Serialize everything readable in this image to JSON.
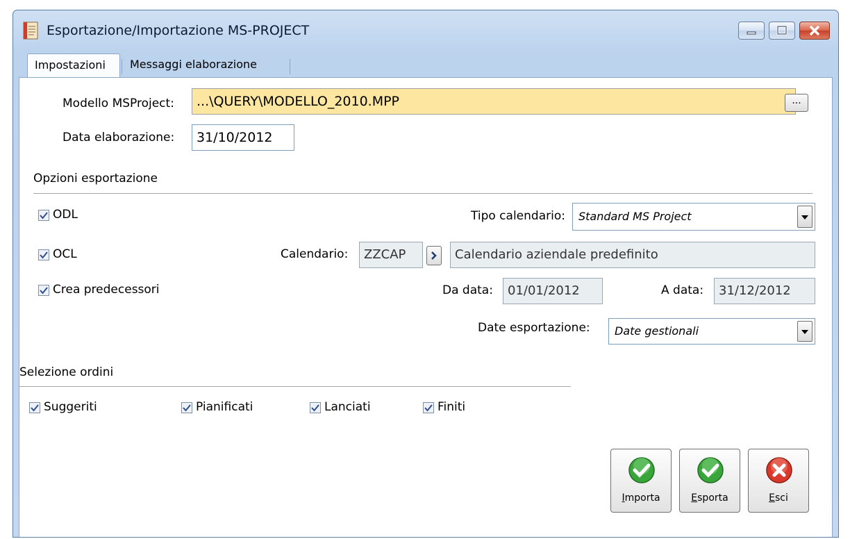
{
  "window": {
    "title": "Esportazione/Importazione MS-PROJECT"
  },
  "tabs": [
    {
      "label": "Impostazioni",
      "active": true
    },
    {
      "label": "Messaggi elaborazione",
      "active": false
    }
  ],
  "form": {
    "modello_label": "Modello MSProject:",
    "modello_value": "...\\QUERY\\MODELLO_2010.MPP",
    "browse_label": "...",
    "data_label": "Data elaborazione:",
    "data_value": "31/10/2012"
  },
  "export_options": {
    "section_label": "Opzioni esportazione",
    "odl_label": "ODL",
    "ocl_label": "OCL",
    "predecessori_label": "Crea predecessori",
    "tipo_calendario_label": "Tipo calendario:",
    "tipo_calendario_value": "Standard MS Project",
    "calendario_label": "Calendario:",
    "calendario_code": "ZZCAP",
    "calendario_desc": "Calendario aziendale predefinito",
    "da_data_label": "Da data:",
    "da_data_value": "01/01/2012",
    "a_data_label": "A data:",
    "a_data_value": "31/12/2012",
    "date_esportazione_label": "Date esportazione:",
    "date_esportazione_value": "Date gestionali"
  },
  "order_selection": {
    "section_label": "Selezione ordini",
    "suggeriti_label": "Suggeriti",
    "pianificati_label": "Pianificati",
    "lanciati_label": "Lanciati",
    "finiti_label": "Finiti"
  },
  "buttons": {
    "importa": {
      "mnemonic": "I",
      "rest": "mporta"
    },
    "esporta": {
      "mnemonic": "E",
      "rest": "sporta"
    },
    "esci": {
      "mnemonic": "E",
      "rest": "sci"
    }
  },
  "colors": {
    "required_field": "#fde6a0",
    "readonly_field": "#e9eef1",
    "ok_green": "#3aa53a",
    "close_red": "#d9392b"
  }
}
